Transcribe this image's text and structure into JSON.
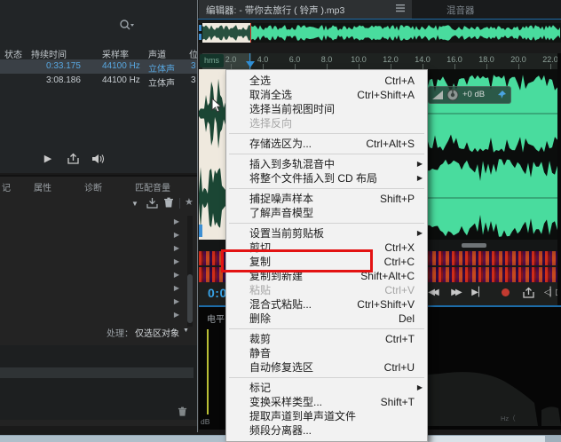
{
  "colors": {
    "accent_blue": "#37a3e8",
    "wave_green": "#49dc9e",
    "selection_white": "#efe9de",
    "annotation_red": "#e31313",
    "record_red": "#c23a30",
    "panel_border_blue": "#1d6ca8"
  },
  "files_panel": {
    "search_icon": "magnifier",
    "columns": [
      "状态",
      "持续时间",
      "采样率",
      "声道",
      "位"
    ],
    "rows": [
      {
        "status": "",
        "duration": "0:33.175",
        "rate": "44100 Hz",
        "channels": "立体声",
        "bits": "3",
        "selected": true
      },
      {
        "status": "",
        "duration": "3:08.186",
        "rate": "44100 Hz",
        "channels": "立体声",
        "bits": "3",
        "selected": false
      }
    ],
    "transport": {
      "play": "▶"
    }
  },
  "props_panel": {
    "tabs": [
      {
        "label": "记"
      },
      {
        "label": "属性"
      },
      {
        "label": "诊断"
      },
      {
        "label": "匹配音量"
      }
    ],
    "collapsed_rows": 8,
    "process_label": "处理：",
    "process_value": "仅选区对象"
  },
  "editor": {
    "tab_title": "编辑器: - 带你去旅行 ( 铃声 ).mp3",
    "tab2_title": "混音器",
    "ruler_unit": "hms",
    "ruler_ticks": [
      "2.0",
      "4.0",
      "6.0",
      "8.0",
      "10.0",
      "12.0",
      "14.0",
      "16.0",
      "18.0",
      "20.0",
      "22.0"
    ],
    "hud_gain": "+0 dB",
    "time_display": "0:0",
    "level_panel_title": "电平",
    "db_axis_label": "dB",
    "hz_axis_label": "Hz（"
  },
  "context_menu": {
    "items": [
      {
        "label": "全选",
        "shortcut": "Ctrl+A"
      },
      {
        "label": "取消全选",
        "shortcut": "Ctrl+Shift+A"
      },
      {
        "label": "选择当前视图时间"
      },
      {
        "label": "选择反向",
        "disabled": true,
        "sep": true
      },
      {
        "label": "存储选区为...",
        "shortcut": "Ctrl+Alt+S",
        "sep": true
      },
      {
        "label": "插入到多轨混音中",
        "submenu": true
      },
      {
        "label": "将整个文件插入到 CD 布局",
        "submenu": true,
        "sep": true
      },
      {
        "label": "捕捉噪声样本",
        "shortcut": "Shift+P"
      },
      {
        "label": "了解声音模型",
        "sep": true
      },
      {
        "label": "设置当前剪贴板",
        "submenu": true
      },
      {
        "label": "剪切",
        "shortcut": "Ctrl+X"
      },
      {
        "label": "复制",
        "shortcut": "Ctrl+C",
        "boxed": true
      },
      {
        "label": "复制到新建",
        "shortcut": "Shift+Alt+C"
      },
      {
        "label": "粘贴",
        "shortcut": "Ctrl+V",
        "disabled": true
      },
      {
        "label": "混合式粘贴...",
        "shortcut": "Ctrl+Shift+V"
      },
      {
        "label": "删除",
        "shortcut": "Del",
        "sep": true
      },
      {
        "label": "裁剪",
        "shortcut": "Ctrl+T"
      },
      {
        "label": "静音"
      },
      {
        "label": "自动修复选区",
        "shortcut": "Ctrl+U",
        "sep": true
      },
      {
        "label": "标记",
        "submenu": true
      },
      {
        "label": "变换采样类型...",
        "shortcut": "Shift+T"
      },
      {
        "label": "提取声道到单声道文件"
      },
      {
        "label": "频段分离器..."
      }
    ]
  },
  "annotation": {
    "type": "red-box",
    "target": "复制"
  }
}
